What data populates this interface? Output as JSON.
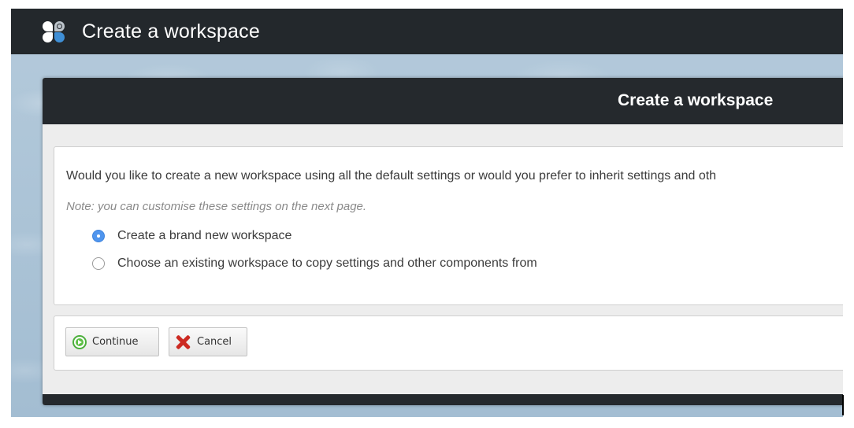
{
  "app": {
    "title": "Create a workspace",
    "logo_icon": "app-logo-icon"
  },
  "dialog": {
    "title": "Create a workspace",
    "question": "Would you like to create a new workspace using all the default settings or would you prefer to inherit settings and oth",
    "note": "Note: you can customise these settings on the next page.",
    "options": [
      {
        "label": "Create a brand new workspace",
        "selected": true
      },
      {
        "label": "Choose an existing workspace to copy settings and other components from",
        "selected": false
      }
    ],
    "buttons": {
      "continue_label": "Continue",
      "continue_icon": "continue-arrow-icon",
      "cancel_label": "Cancel",
      "cancel_icon": "cancel-x-icon"
    }
  },
  "colors": {
    "header_bg": "#23282c",
    "accent_radio": "#4f95ee",
    "continue_icon": "#5cbf44",
    "cancel_icon": "#cc2a22"
  }
}
